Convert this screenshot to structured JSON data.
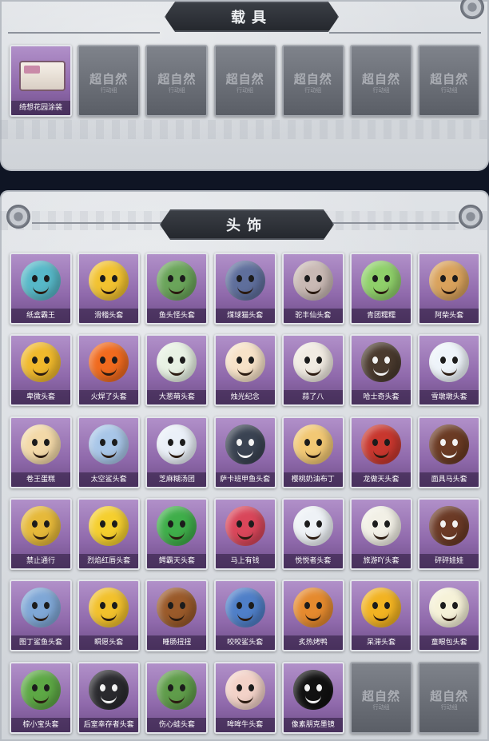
{
  "vehicle_section": {
    "title": "载具",
    "items": [
      {
        "label": "绮想花园涂装",
        "locked": false,
        "icon": "food-truck-icon",
        "color": "#f3ece4"
      }
    ],
    "locked_slots": 6,
    "locked_logo": "超自然",
    "locked_sub": "行动组"
  },
  "head_section": {
    "title": "头饰",
    "items": [
      {
        "label": "纸盒霸王",
        "icon": "box-shark-icon",
        "color": "#57b8c8"
      },
      {
        "label": "滑稽头套",
        "icon": "smiley-icon",
        "color": "#f2c230"
      },
      {
        "label": "鱼头怪头套",
        "icon": "fish-head-icon",
        "color": "#6aa45a"
      },
      {
        "label": "煤球猫头套",
        "icon": "cat-head-icon",
        "color": "#5f6f9c"
      },
      {
        "label": "驼丰仙头套",
        "icon": "cool-cat-icon",
        "color": "#c9b9b4"
      },
      {
        "label": "青团糯糯",
        "icon": "green-ball-icon",
        "color": "#8fd06a"
      },
      {
        "label": "阿柴头套",
        "icon": "shiba-icon",
        "color": "#d9a25c"
      },
      {
        "label": "卑微头套",
        "icon": "worried-face-icon",
        "color": "#f0b92c"
      },
      {
        "label": "火焊了头套",
        "icon": "fire-icon",
        "color": "#f06a1e"
      },
      {
        "label": "大葱萌头套",
        "icon": "scallion-icon",
        "color": "#e8f2e4"
      },
      {
        "label": "烛光纪念",
        "icon": "candle-icon",
        "color": "#f7e2c8"
      },
      {
        "label": "蒜了八",
        "icon": "garlic-icon",
        "color": "#f1ebe2"
      },
      {
        "label": "哈士奇头套",
        "icon": "dog-head-icon",
        "color": "#4a3a2e"
      },
      {
        "label": "雪墩墩头套",
        "icon": "snowman-icon",
        "color": "#eef4fa"
      },
      {
        "label": "卷王蛋糕",
        "icon": "cake-roll-icon",
        "color": "#f3d9a8"
      },
      {
        "label": "太空鲨头套",
        "icon": "shark-icon",
        "color": "#a8c6e8"
      },
      {
        "label": "芝麻糊汤团",
        "icon": "dumpling-icon",
        "color": "#eaf0f8"
      },
      {
        "label": "萨卡班甲鱼头套",
        "icon": "fish-icon",
        "color": "#3a4352"
      },
      {
        "label": "樱桃奶油布丁",
        "icon": "pudding-icon",
        "color": "#f2c874"
      },
      {
        "label": "龙做天头套",
        "icon": "dragon-icon",
        "color": "#c8372e"
      },
      {
        "label": "面具马头套",
        "icon": "horse-icon",
        "color": "#6b3b24"
      },
      {
        "label": "禁止通行",
        "icon": "traffic-cone-icon",
        "color": "#e6b93a"
      },
      {
        "label": "烈焰红唇头套",
        "icon": "pikachu-icon",
        "color": "#f5cf2e"
      },
      {
        "label": "鳄霸天头套",
        "icon": "crocodile-icon",
        "color": "#3fae4a"
      },
      {
        "label": "马上有钱",
        "icon": "red-horse-icon",
        "color": "#d9465a"
      },
      {
        "label": "悦悦者头套",
        "icon": "cloud-icon",
        "color": "#eef2f6"
      },
      {
        "label": "旅游吖头套",
        "icon": "duck-icon",
        "color": "#f2f0e6"
      },
      {
        "label": "砰砰娃娃",
        "icon": "doll-icon",
        "color": "#6b3a26"
      },
      {
        "label": "图丁鲨鱼头套",
        "icon": "shark-hat-icon",
        "color": "#7fa7d6"
      },
      {
        "label": "瞬愿头套",
        "icon": "grin-face-icon",
        "color": "#f2c12c"
      },
      {
        "label": "睡肠扭扭",
        "icon": "dachshund-icon",
        "color": "#9a5a2a"
      },
      {
        "label": "咬咬鲨头套",
        "icon": "bite-shark-icon",
        "color": "#4f7fc8"
      },
      {
        "label": "炙热烤鸭",
        "icon": "toast-icon",
        "color": "#e58a2e"
      },
      {
        "label": "呆滞头套",
        "icon": "stare-face-icon",
        "color": "#f2b322"
      },
      {
        "label": "童眼包头套",
        "icon": "bun-icon",
        "color": "#f6f2d8"
      },
      {
        "label": "棕小宝头套",
        "icon": "zongzi-icon",
        "color": "#5da845"
      },
      {
        "label": "后室幸存者头套",
        "icon": "gas-mask-icon",
        "color": "#2a2a2e"
      },
      {
        "label": "伤心蛙头套",
        "icon": "frog-icon",
        "color": "#5f9c4a"
      },
      {
        "label": "哞哞牛头套",
        "icon": "cow-icon",
        "color": "#f3d2c8"
      },
      {
        "label": "像素朋克墨镜",
        "icon": "pixel-sunglasses-icon",
        "color": "#111111"
      }
    ],
    "locked_slots": 2,
    "locked_logo": "超自然",
    "locked_sub": "行动组"
  }
}
